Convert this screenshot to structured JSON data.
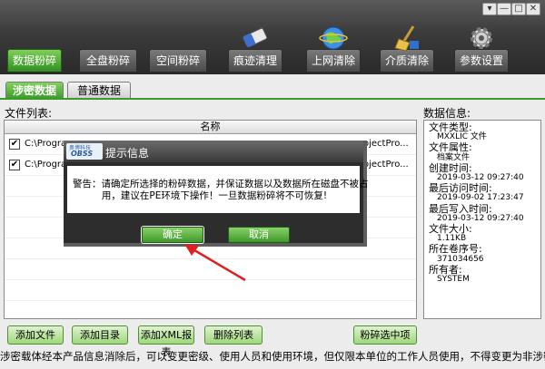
{
  "window": {
    "controls": [
      "▾",
      "—",
      "□",
      "✕"
    ]
  },
  "toolbar": {
    "tabs": [
      {
        "label": "数据粉碎",
        "icon": "shred-icon"
      },
      {
        "label": "全盘粉碎",
        "icon": "disk-icon"
      },
      {
        "label": "空间粉碎",
        "icon": "space-icon"
      },
      {
        "label": "痕迹清理",
        "icon": "eraser-icon"
      },
      {
        "label": "上网清除",
        "icon": "globe-icon"
      },
      {
        "label": "介质清除",
        "icon": "broom-icon"
      },
      {
        "label": "参数设置",
        "icon": "gear-icon"
      }
    ],
    "active_color": "#3a9a2a"
  },
  "subtabs": {
    "items": [
      "涉密数据",
      "普通数据"
    ]
  },
  "file_list": {
    "label": "文件列表:",
    "column_header": "名称",
    "rows": [
      {
        "checked": true,
        "path": "C:\\Program",
        "path_end": "ojectPro..."
      },
      {
        "checked": true,
        "path": "C:\\Program",
        "path_end": "ojectPro..."
      }
    ]
  },
  "info": {
    "label": "数据信息:",
    "lines": [
      {
        "kind": "label",
        "text": "文件类型:"
      },
      {
        "kind": "value",
        "text": "MXXLIC 文件"
      },
      {
        "kind": "label",
        "text": "文件属性:"
      },
      {
        "kind": "value",
        "text": "档案文件"
      },
      {
        "kind": "label",
        "text": "创建时间:"
      },
      {
        "kind": "value",
        "text": "2019-03-12 09:27:40"
      },
      {
        "kind": "label",
        "text": "最后访问时间:"
      },
      {
        "kind": "value",
        "text": "2019-09-02 17:23:47"
      },
      {
        "kind": "label",
        "text": "最后写入时间:"
      },
      {
        "kind": "value",
        "text": "2019-03-12 09:27:40"
      },
      {
        "kind": "label",
        "text": "文件大小:"
      },
      {
        "kind": "value",
        "text": "1.11KB"
      },
      {
        "kind": "label",
        "text": "所在卷序号:"
      },
      {
        "kind": "value",
        "text": "371034656"
      },
      {
        "kind": "label",
        "text": "所有者:"
      },
      {
        "kind": "value",
        "text": "SYSTEM"
      }
    ]
  },
  "bottom_buttons": {
    "add_file": "添加文件",
    "add_dir": "添加目录",
    "add_xml": "添加XML报表",
    "delete_list": "删除列表",
    "shred_selected": "粉碎选中项"
  },
  "status_text": "涉密载体经本产品信息消除后，可以变更密级、使用人员和使用环境，但仅限本单位的工作人员使用，不得变更为非涉密载体使用。",
  "dialog": {
    "logo_text": "OBSS",
    "logo_small": "奥博科技",
    "title": "提示信息",
    "message_line1": "警告：请确定所选择的粉碎数据，并保证数据以及数据所在磁盘不被占",
    "message_line2": "用，建议在PE环境下操作！一旦数据粉碎将不可恢复!",
    "ok_label": "确定",
    "cancel_label": "取消"
  }
}
